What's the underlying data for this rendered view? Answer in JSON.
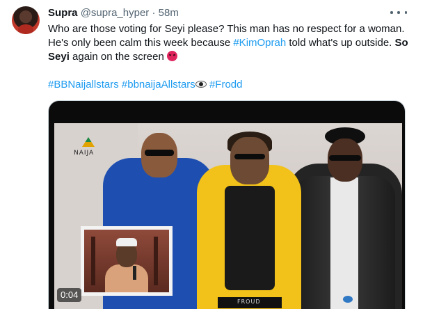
{
  "author": {
    "name": "Supra",
    "handle": "@supra_hyper",
    "separator": "·",
    "time": "58m"
  },
  "tweet": {
    "text_part1": "Who are those voting for Seyi please? This man has no respect for a woman. He's only been calm this week because ",
    "hashtag_kimoprah": "#KimOprah",
    "text_part2": " told what's up outside. ",
    "bold_text": " So Seyi",
    "text_part3": " again on the screen ",
    "emoji_angry": "angry-face-emoji",
    "hashtags": [
      "#BBNaijallstars",
      "#bbnaijaAllstars",
      "#Frodd"
    ],
    "emoji_eye": "eye-emoji"
  },
  "media": {
    "type": "video",
    "duration": "0:04",
    "logo_text": "NAIJA",
    "belt_text": "FROUD"
  },
  "icons": {
    "more": "more-horizontal-icon"
  },
  "colors": {
    "link": "#1d9bf0",
    "text": "#0f1419",
    "muted": "#536471"
  }
}
